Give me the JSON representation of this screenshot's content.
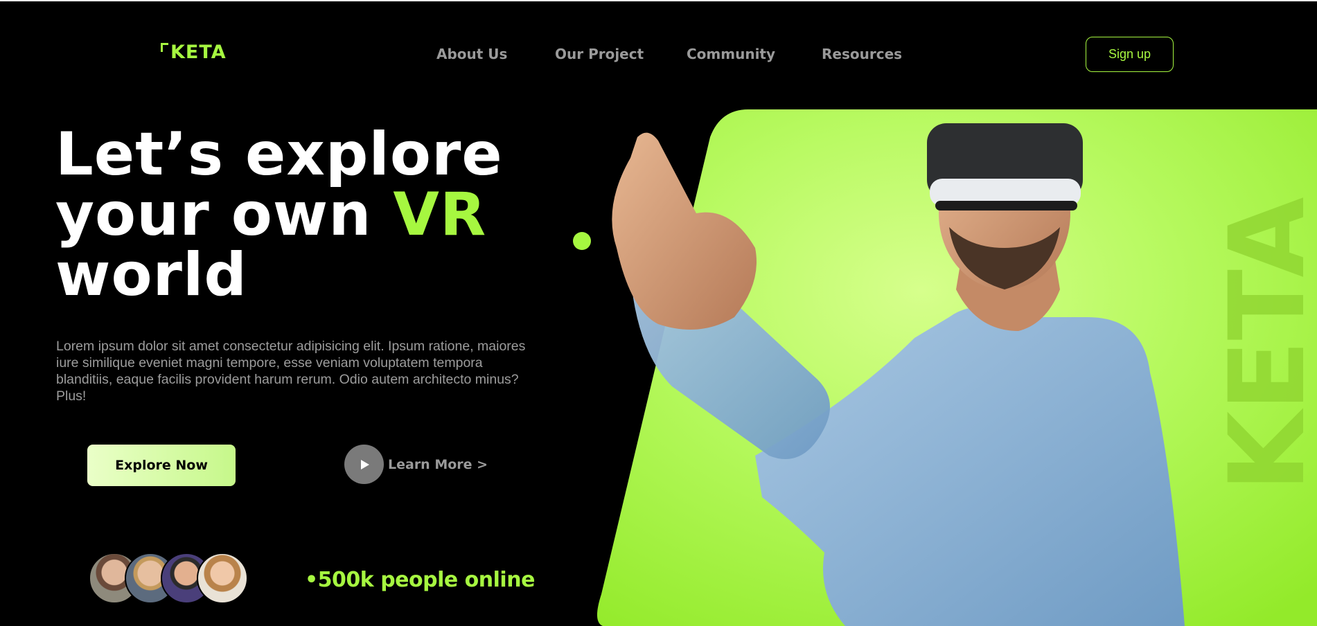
{
  "header": {
    "logo": "KETA",
    "nav": [
      "About Us",
      "Our Project",
      "Community",
      "Resources"
    ],
    "signup_label": "Sign up"
  },
  "hero": {
    "headline_line1": "Let’s explore",
    "headline_line2_prefix": "your own ",
    "headline_accent": "VR",
    "headline_line3": "world",
    "description": "Lorem ipsum dolor sit amet consectetur adipisicing elit. Ipsum ratione, maiores iure similique eveniet magni tempore, esse veniam voluptatem tempora blanditiis, eaque facilis provident harum rerum. Odio autem architecto minus? Plus!",
    "explore_label": "Explore Now",
    "learn_more_label": "Learn More >",
    "online_text": "•500k people online",
    "background_word": "KETA"
  },
  "colors": {
    "accent": "#a6f740",
    "background": "#000000",
    "nav_text": "#9a9a9a"
  },
  "icons": {
    "play": "play-icon"
  }
}
